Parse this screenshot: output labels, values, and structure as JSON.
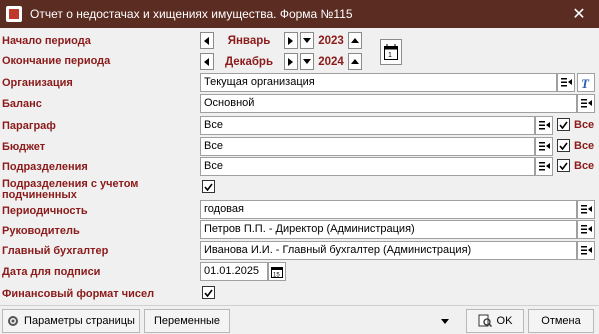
{
  "window": {
    "title": "Отчет о недостачах и хищениях имущества. Форма №115",
    "close_glyph": "✕"
  },
  "period": {
    "start_label": "Начало периода",
    "end_label": "Окончание периода",
    "start_month": "Январь",
    "start_year": "2023",
    "end_month": "Декабрь",
    "end_year": "2024"
  },
  "fields": {
    "organization": {
      "label": "Организация",
      "value": "Текущая организация"
    },
    "balance": {
      "label": "Баланс",
      "value": "Основной"
    },
    "paragraph": {
      "label": "Параграф",
      "value": "Все",
      "all_label": "Все",
      "all_checked": true
    },
    "budget": {
      "label": "Бюджет",
      "value": "Все",
      "all_label": "Все",
      "all_checked": true
    },
    "divisions": {
      "label": "Подразделения",
      "value": "Все",
      "all_label": "Все",
      "all_checked": true
    },
    "divisions_sub": {
      "label_line1": "Подразделения с учетом",
      "label_line2": "подчиненных",
      "checked": true
    },
    "periodicity": {
      "label": "Периодичность",
      "value": "годовая"
    },
    "head": {
      "label": "Руководитель",
      "value": "Петров П.П. - Директор  (Администрация)"
    },
    "chief_accountant": {
      "label": "Главный бухгалтер",
      "value": "Иванова И.И. - Главный бухгалтер  (Администрация)"
    },
    "sign_date": {
      "label": "Дата для подписи",
      "value": "01.01.2025"
    },
    "fin_format": {
      "label": "Финансовый формат чисел",
      "checked": true
    }
  },
  "footer": {
    "page_params": "Параметры страницы",
    "variables": "Переменные",
    "ok": "OK",
    "cancel": "Отмена"
  },
  "colors": {
    "titlebar": "#5b2c22",
    "label": "#8b1a1a"
  }
}
